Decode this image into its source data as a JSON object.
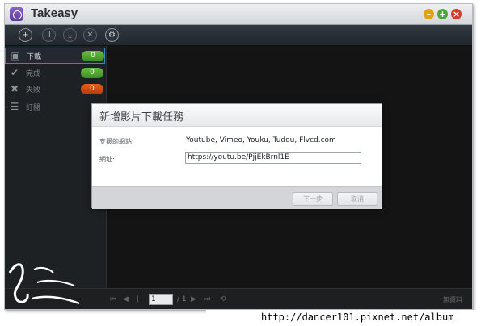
{
  "window": {
    "title": "Takeasy"
  },
  "sidebar": {
    "items": [
      {
        "label": "下載",
        "count": "0",
        "icon": "download-list-icon",
        "color": "#4ea634"
      },
      {
        "label": "完成",
        "count": "0",
        "icon": "check-icon",
        "color": "#4ea634"
      },
      {
        "label": "失敗",
        "count": "0",
        "icon": "x-icon",
        "color": "#d5501a"
      },
      {
        "label": "訂閱",
        "count": "",
        "icon": "rss-icon",
        "color": ""
      }
    ]
  },
  "pagination": {
    "page": "1",
    "total": "/ 1",
    "no_data": "無資料"
  },
  "dialog": {
    "title": "新增影片下載任務",
    "supported_label": "支援的網站:",
    "supported_value": "Youtube, Vimeo, Youku, Tudou, Flvcd.com",
    "url_label": "網址:",
    "url_value": "https://youtu.be/PjjEkBrnl1E",
    "next_button": "下一步",
    "cancel_button": "取消"
  },
  "watermark": {
    "url": "http://dancer101.pixnet.net/album"
  }
}
